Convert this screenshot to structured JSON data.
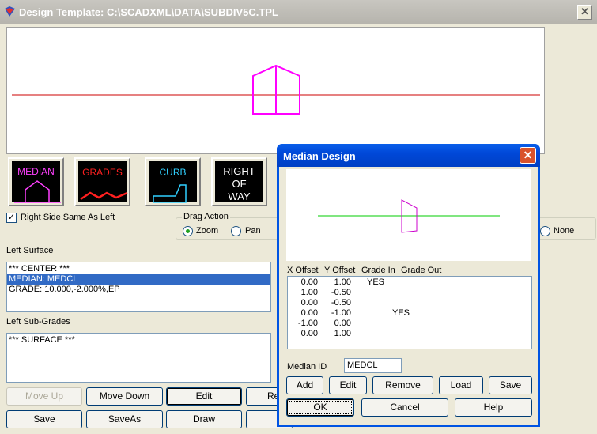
{
  "window": {
    "title": "Design Template: C:\\SCADXML\\DATA\\SUBDIV5C.TPL",
    "close_glyph": "✕"
  },
  "toolbar": {
    "median_label": "MEDIAN",
    "grades_label": "GRADES",
    "curb_label": "CURB",
    "row_label_1": "RIGHT",
    "row_label_2": "OF",
    "row_label_3": "WAY"
  },
  "right_side_checkbox": {
    "label": "Right Side Same As Left",
    "checked": "✓"
  },
  "drag_action": {
    "legend": "Drag Action",
    "zoom": "Zoom",
    "pan": "Pan",
    "none": "None"
  },
  "left_surface": {
    "label": "Left Surface",
    "items": [
      "*** CENTER ***",
      "MEDIAN: MEDCL",
      "GRADE: 10.000,-2.000%,EP"
    ]
  },
  "left_subgrades": {
    "label": "Left Sub-Grades",
    "items": [
      "*** SURFACE ***"
    ]
  },
  "buttons": {
    "move_up": "Move Up",
    "move_down": "Move Down",
    "edit": "Edit",
    "re_partial": "Re",
    "save": "Save",
    "save_as": "SaveAs",
    "draw": "Draw"
  },
  "median_dialog": {
    "title": "Median Design",
    "close_glyph": "✕",
    "headers": {
      "x": "X Offset",
      "y": "Y Offset",
      "grade_in": "Grade In",
      "grade_out": "Grade Out"
    },
    "rows": [
      {
        "x": "0.00",
        "y": "1.00",
        "gin": "YES",
        "gout": ""
      },
      {
        "x": "1.00",
        "y": "-0.50",
        "gin": "",
        "gout": ""
      },
      {
        "x": "0.00",
        "y": "-0.50",
        "gin": "",
        "gout": ""
      },
      {
        "x": "0.00",
        "y": "-1.00",
        "gin": "",
        "gout": "YES"
      },
      {
        "x": "-1.00",
        "y": "0.00",
        "gin": "",
        "gout": ""
      },
      {
        "x": "0.00",
        "y": "1.00",
        "gin": "",
        "gout": ""
      }
    ],
    "median_id_label": "Median ID",
    "median_id_value": "MEDCL",
    "add": "Add",
    "edit": "Edit",
    "remove": "Remove",
    "load": "Load",
    "save": "Save",
    "ok": "OK",
    "cancel": "Cancel",
    "help": "Help"
  },
  "colors": {
    "median_shape": "#ff00ff",
    "center_line_main": "#cc0000",
    "grades_icon": "#ff2020",
    "curb_icon": "#30d0ff",
    "dialog_line": "#00cc00",
    "dialog_titlebar": "#0050e0",
    "selection": "#316ac5"
  }
}
